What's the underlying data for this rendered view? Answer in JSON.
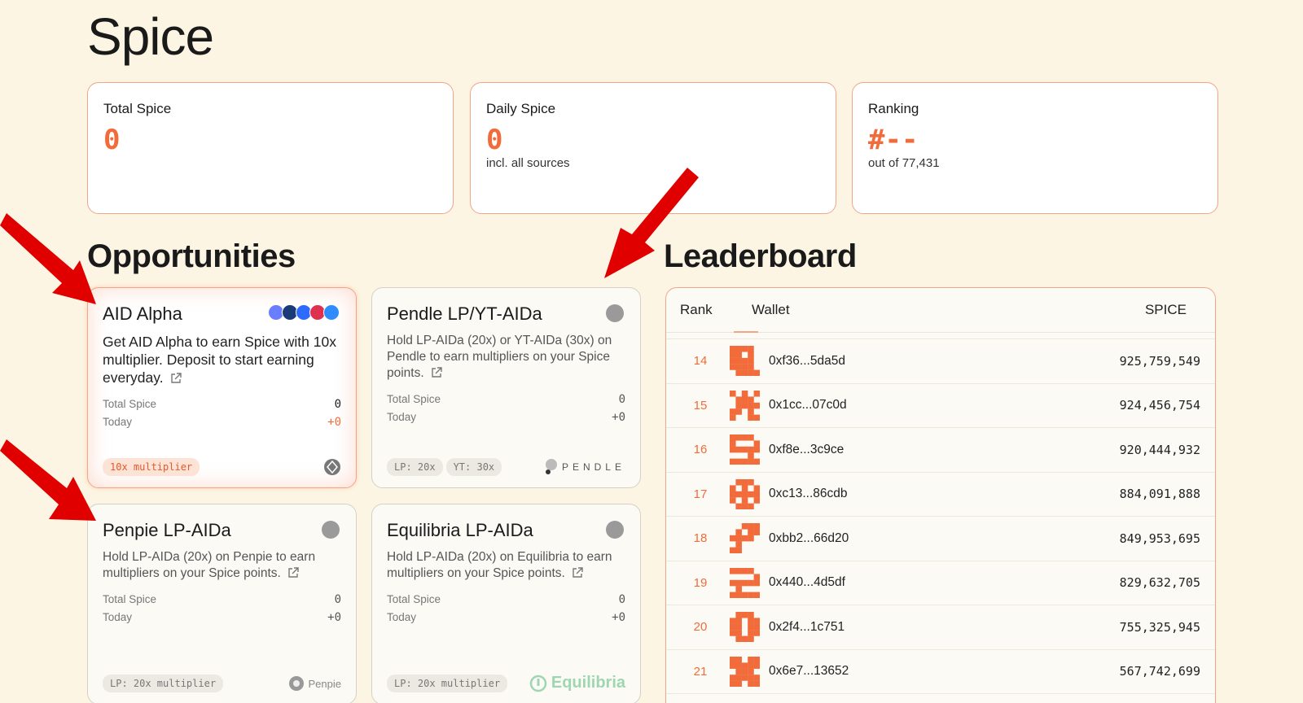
{
  "page": {
    "title": "Spice"
  },
  "stats": [
    {
      "label": "Total Spice",
      "value": "0",
      "sub": ""
    },
    {
      "label": "Daily Spice",
      "value": "0",
      "sub": "incl. all sources"
    },
    {
      "label": "Ranking",
      "value": "#--",
      "sub": "out of 77,431"
    }
  ],
  "opportunities": {
    "title": "Opportunities",
    "cards": [
      {
        "title": "AID Alpha",
        "desc": "Get AID Alpha to earn Spice with 10x multiplier. Deposit to start earning everyday.",
        "total_label": "Total Spice",
        "total_value": "0",
        "today_label": "Today",
        "today_value": "+0",
        "badges": [
          "10x multiplier"
        ],
        "brand": ""
      },
      {
        "title": "Pendle LP/YT-AIDa",
        "desc": "Hold LP-AIDa (20x) or YT-AIDa (30x) on Pendle to earn multipliers on your Spice points.",
        "total_label": "Total Spice",
        "total_value": "0",
        "today_label": "Today",
        "today_value": "+0",
        "badges": [
          "LP: 20x",
          "YT: 30x"
        ],
        "brand": "PENDLE"
      },
      {
        "title": "Penpie LP-AIDa",
        "desc": "Hold LP-AIDa (20x) on Penpie to earn multipliers on your Spice points.",
        "total_label": "Total Spice",
        "total_value": "0",
        "today_label": "Today",
        "today_value": "+0",
        "badges": [
          "LP: 20x multiplier"
        ],
        "brand": "Penpie"
      },
      {
        "title": "Equilibria LP-AIDa",
        "desc": "Hold LP-AIDa (20x) on Equilibria to earn multipliers on your Spice points.",
        "total_label": "Total Spice",
        "total_value": "0",
        "today_label": "Today",
        "today_value": "+0",
        "badges": [
          "LP: 20x multiplier"
        ],
        "brand": "Equilibria"
      }
    ]
  },
  "leaderboard": {
    "title": "Leaderboard",
    "columns": {
      "rank": "Rank",
      "wallet": "Wallet",
      "spice": "SPICE"
    },
    "rows": [
      {
        "rank": "14",
        "wallet": "0xf36...5da5d",
        "spice": "925,759,549"
      },
      {
        "rank": "15",
        "wallet": "0x1cc...07c0d",
        "spice": "924,456,754"
      },
      {
        "rank": "16",
        "wallet": "0xf8e...3c9ce",
        "spice": "920,444,932"
      },
      {
        "rank": "17",
        "wallet": "0xc13...86cdb",
        "spice": "884,091,888"
      },
      {
        "rank": "18",
        "wallet": "0xbb2...66d20",
        "spice": "849,953,695"
      },
      {
        "rank": "19",
        "wallet": "0x440...4d5df",
        "spice": "829,632,705"
      },
      {
        "rank": "20",
        "wallet": "0x2f4...1c751",
        "spice": "755,325,945"
      },
      {
        "rank": "21",
        "wallet": "0x6e7...13652",
        "spice": "567,742,699"
      }
    ]
  },
  "colors": {
    "accent": "#f26b3a",
    "background": "#fdf5e3",
    "card_border": "#f2a587",
    "arrow": "#e00000"
  }
}
